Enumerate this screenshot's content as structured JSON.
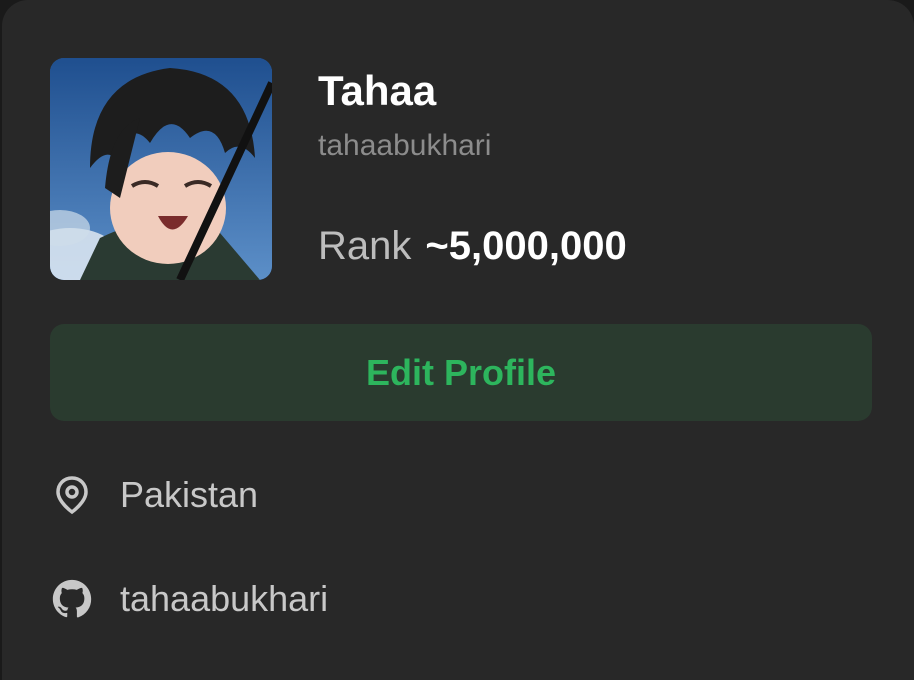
{
  "profile": {
    "name": "Tahaa",
    "username": "tahaabukhari",
    "rank_label": "Rank",
    "rank_value": "~5,000,000",
    "avatar_icon": "anime-avatar-image"
  },
  "actions": {
    "edit_label": "Edit Profile"
  },
  "details": {
    "location": {
      "icon": "location-pin-icon",
      "text": "Pakistan"
    },
    "github": {
      "icon": "github-icon",
      "text": "tahaabukhari"
    }
  },
  "colors": {
    "background": "#282828",
    "accent": "#2db55d",
    "button_bg": "#2a3b2f",
    "text_primary": "#ffffff",
    "text_secondary": "#8c8c8c"
  }
}
